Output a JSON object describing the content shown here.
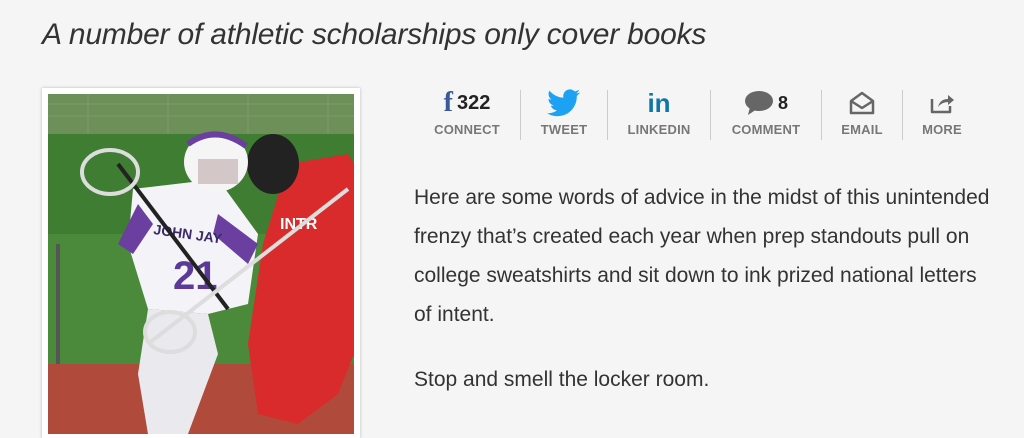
{
  "article": {
    "headline": "A number of athletic scholarships only cover books",
    "paragraphs": [
      "Here are some words of advice in the midst of this unintended frenzy that’s created each year when prep standouts pull on college sweatshirts and sit down to ink prized national letters of intent.",
      "Stop and smell the locker room."
    ]
  },
  "photo": {
    "jersey_text": "JOHN JAY",
    "jersey_number": "21",
    "opponent_jersey_text": "INTR"
  },
  "share": {
    "facebook": {
      "count": "322",
      "label": "CONNECT",
      "icon": "facebook-icon"
    },
    "twitter": {
      "label": "TWEET",
      "icon": "twitter-icon"
    },
    "linkedin": {
      "label": "LINKEDIN",
      "icon": "linkedin-icon"
    },
    "comment": {
      "count": "8",
      "label": "COMMENT",
      "icon": "comment-icon"
    },
    "email": {
      "label": "EMAIL",
      "icon": "email-icon"
    },
    "more": {
      "label": "MORE",
      "icon": "share-icon"
    }
  },
  "colors": {
    "facebook": "#3b5998",
    "twitter": "#1da1f2",
    "linkedin": "#0e76a8",
    "icon_gray": "#666666"
  }
}
